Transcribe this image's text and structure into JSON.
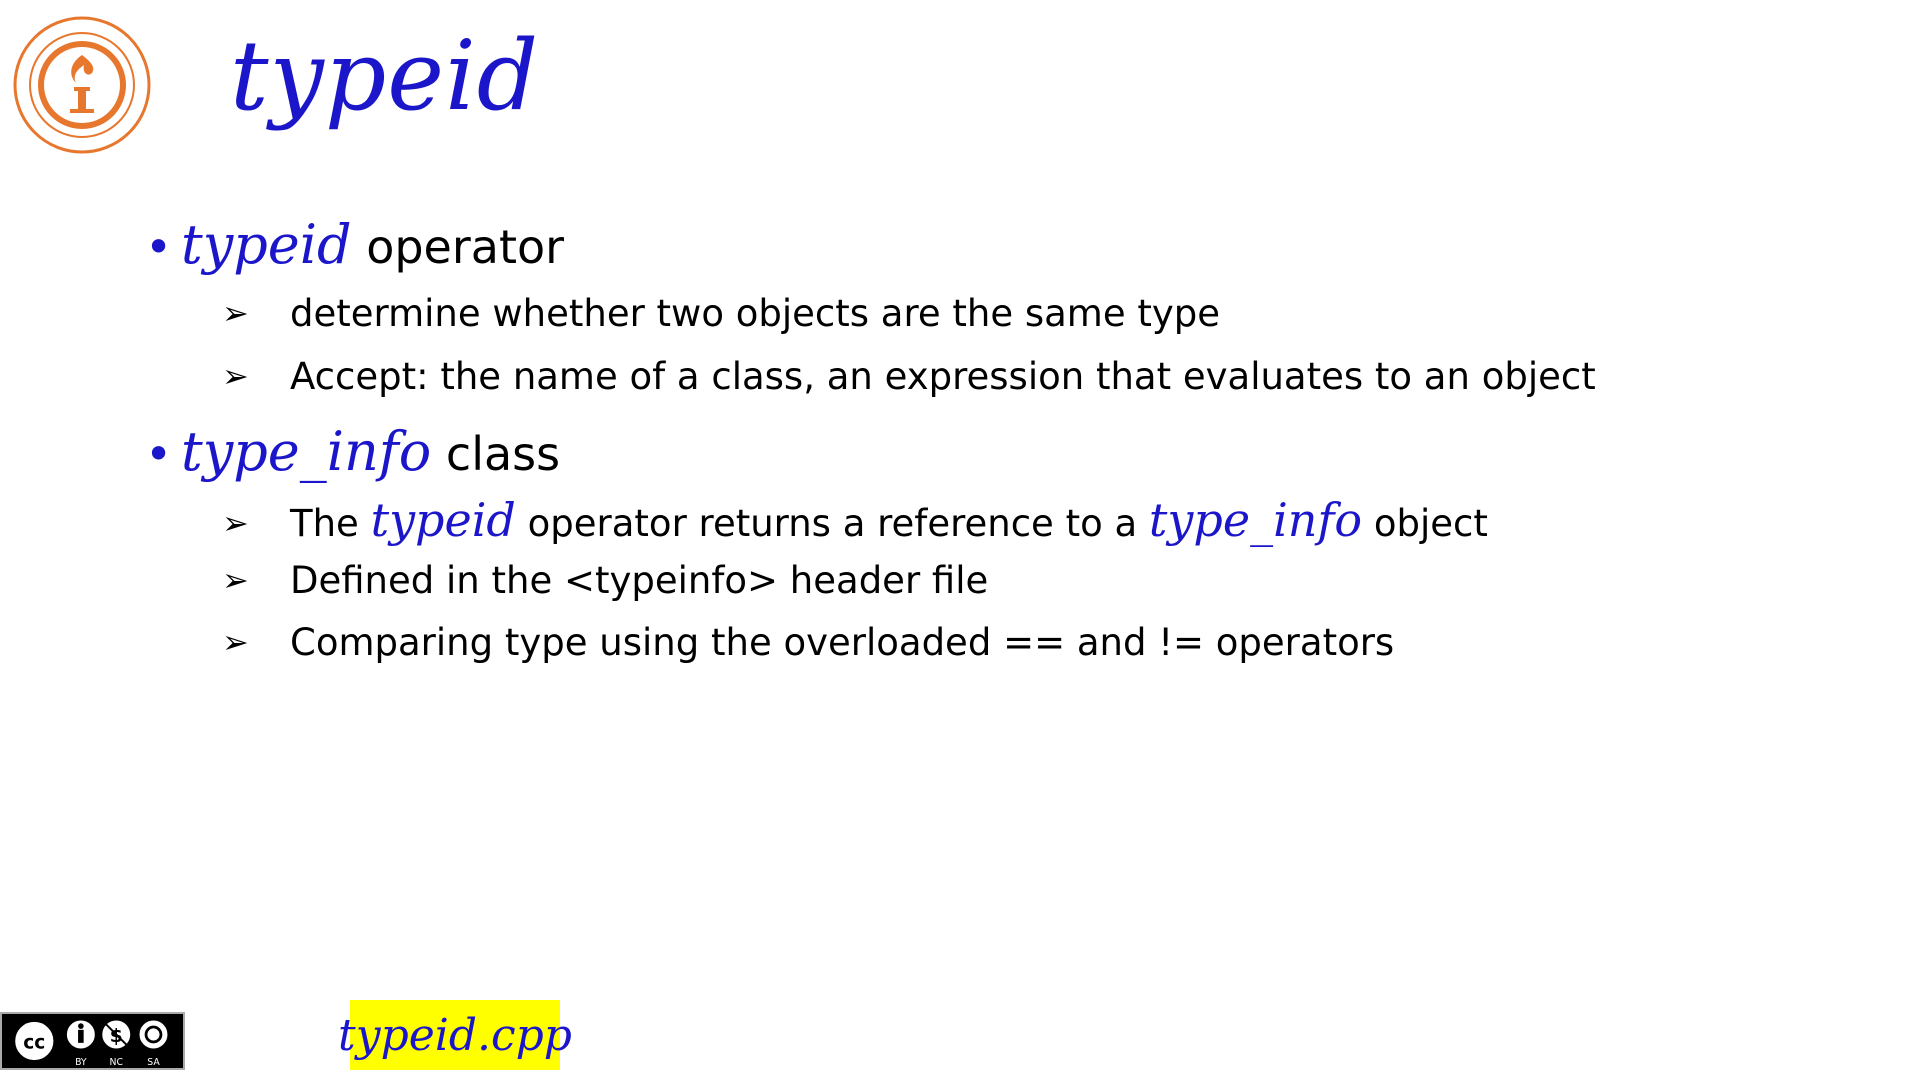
{
  "slide": {
    "title": "typeid",
    "bullets": [
      {
        "code": "typeid",
        "text": " operator",
        "subitems": [
          {
            "parts": [
              "determine whether two objects are the same type"
            ]
          },
          {
            "parts": [
              "Accept: the name of a class, an expression that evaluates to an object"
            ]
          }
        ]
      },
      {
        "code": "type_info",
        "text": " class",
        "subitems": [
          {
            "before": "The ",
            "code1": "typeid",
            "middle": " operator returns a reference to a ",
            "code2": "type_info",
            "after": " object"
          },
          {
            "parts": [
              "Defined in the <typeinfo> header file"
            ]
          },
          {
            "parts": [
              "Comparing type using the overloaded == and != operators"
            ]
          }
        ]
      }
    ],
    "file_label": "typeid.cpp"
  },
  "logo": {
    "name": "university-seal-logo",
    "color": "#e8772e"
  },
  "license": {
    "icons": [
      "cc-icon",
      "by-icon",
      "nc-icon",
      "sa-icon"
    ],
    "labels": [
      "BY",
      "NC",
      "SA"
    ]
  },
  "colors": {
    "code_blue": "#1b16c9",
    "highlight_yellow": "#ffff00",
    "text": "#000000"
  }
}
